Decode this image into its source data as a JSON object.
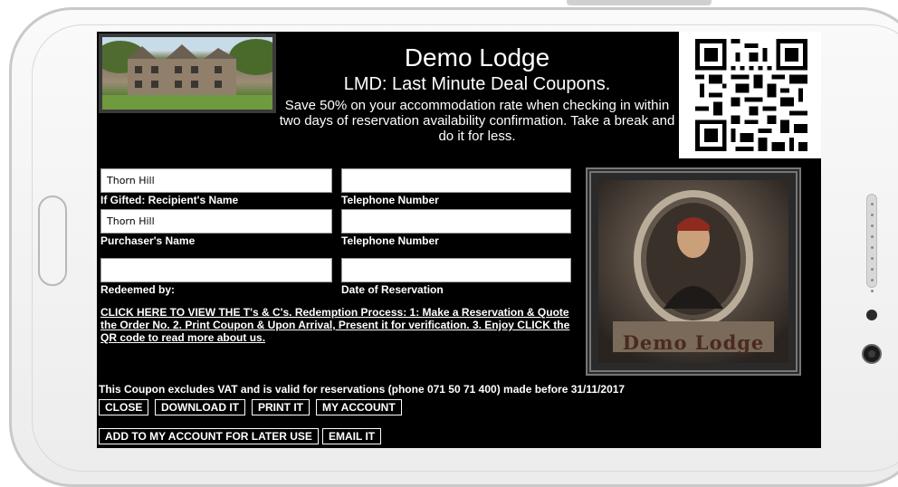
{
  "header": {
    "title": "Demo Lodge",
    "subtitle": "LMD: Last Minute Deal Coupons.",
    "description": "Save 50% on your accommodation rate when checking in within two days of reservation availability confirmation. Take a break and do it for less."
  },
  "form": {
    "recipient_name_value": "Thorn Hill",
    "recipient_name_label": "If Gifted: Recipient's Name",
    "recipient_phone_value": "",
    "recipient_phone_label": "Telephone Number",
    "purchaser_name_value": "Thorn Hill",
    "purchaser_name_label": "Purchaser's Name",
    "purchaser_phone_value": "",
    "purchaser_phone_label": "Telephone Number",
    "redeemed_by_value": "",
    "redeemed_by_label": "Redeemed by:",
    "reservation_date_value": "",
    "reservation_date_label": "Date of Reservation"
  },
  "portrait": {
    "caption": "Demo Lodge"
  },
  "terms_link": "CLICK HERE TO VIEW THE T's & C's. Redemption Process: 1: Make a Reservation & Quote the Order No. 2. Print Coupon & Upon Arrival, Present it for verification. 3. Enjoy CLICK the QR code to read more about us.",
  "footer_note": "This Coupon excludes VAT and is valid for reservations (phone 071 50 71 400) made before 31/11/2017",
  "buttons": {
    "close": "CLOSE",
    "download": "DOWNLOAD IT",
    "print": "PRINT IT",
    "account": "MY ACCOUNT",
    "add_later": "ADD TO MY ACCOUNT FOR LATER USE",
    "email": "EMAIL IT"
  },
  "colors": {
    "screen_bg": "#000000",
    "text": "#ffffff",
    "device": "#f2f2f2"
  }
}
